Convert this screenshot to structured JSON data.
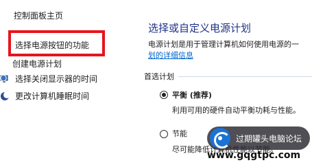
{
  "nav": {
    "home": "控制面板主页",
    "items": [
      {
        "label": "选择电源按钮的功能"
      },
      {
        "label": "创建电源计划"
      },
      {
        "label": "选择关闭显示器的时间",
        "icon": "display-icon"
      },
      {
        "label": "更改计算机睡眠时间",
        "icon": "moon-icon"
      }
    ]
  },
  "main": {
    "title": "选择或自定义电源计划",
    "desc_line1": "电源计划是用于管理计算机如何使用电源的一",
    "desc_link": "划的详细信息",
    "section": "首选计划",
    "plans": [
      {
        "name": "平衡 (推荐)",
        "desc": "利用可用的硬件自动平衡功耗与性能。",
        "selected": true
      },
      {
        "name": "节能",
        "desc": "尽可能降低计算机性能以节能。",
        "selected": false
      }
    ]
  },
  "watermark": {
    "badge_text": "过期罐头电脑论坛",
    "url": "www.gqgtpc.com"
  },
  "colors": {
    "highlight": "#e8141c",
    "title": "#1e3287",
    "link": "#0066cc"
  }
}
